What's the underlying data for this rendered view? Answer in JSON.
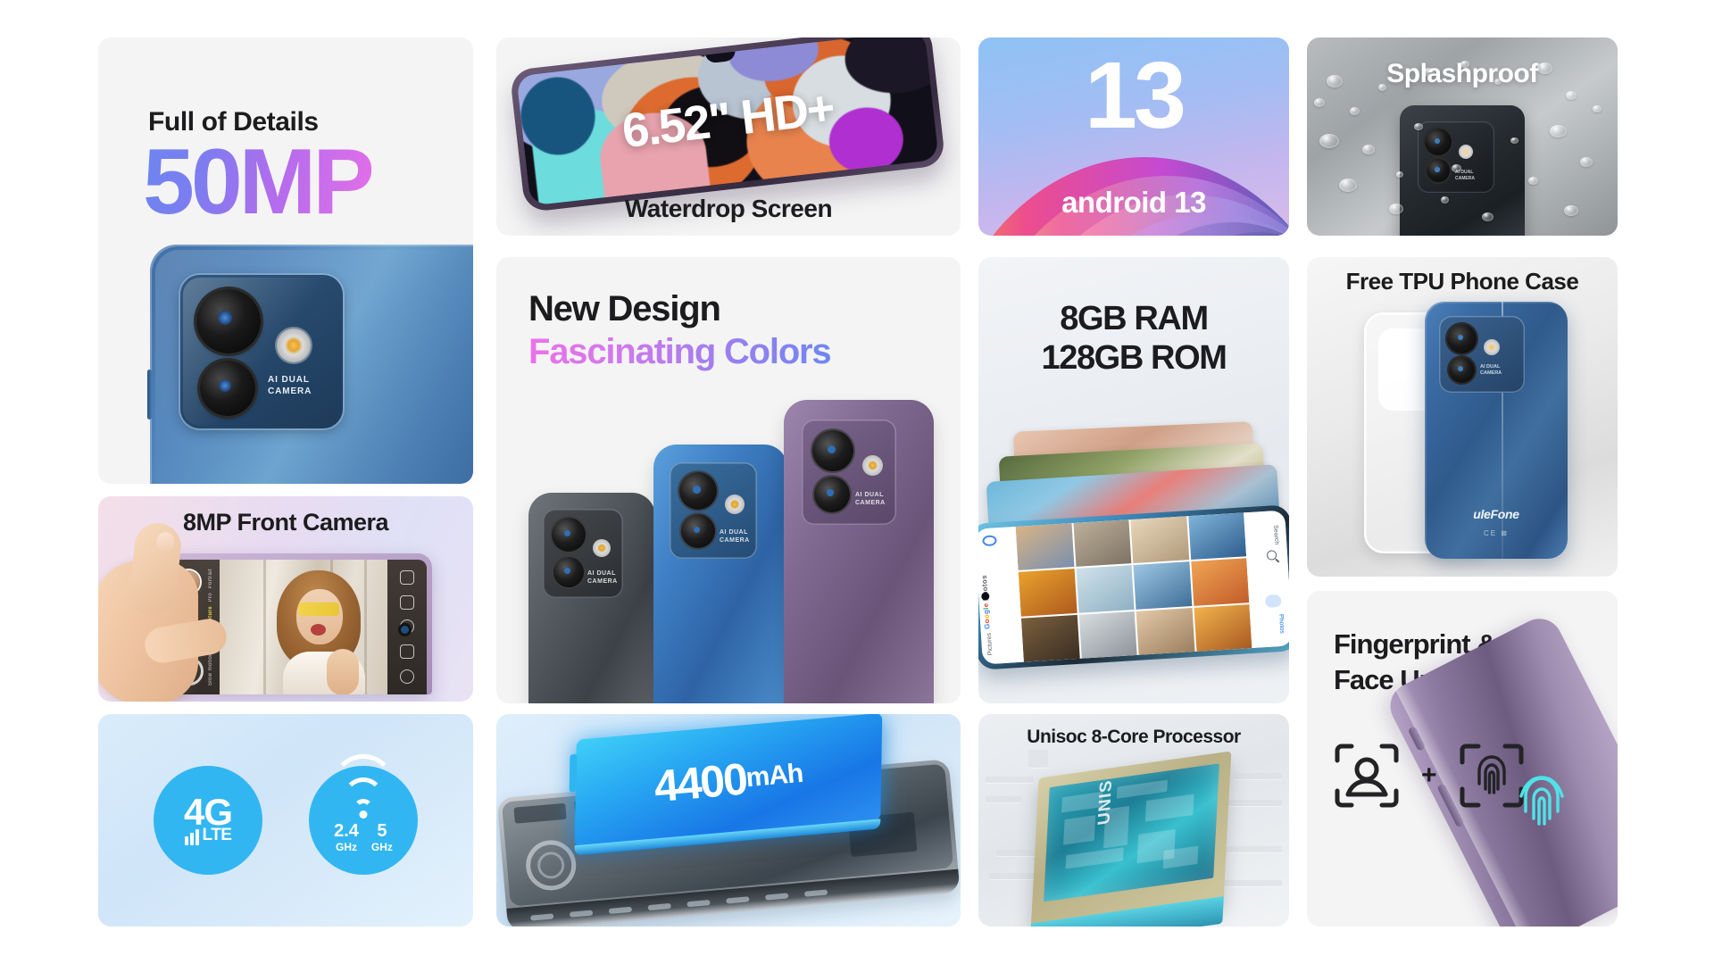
{
  "product": {
    "brand": "ulefone",
    "accent_blue": "#6b86ef",
    "accent_magenta": "#e46fe8",
    "icon_blue": "#31b6f2",
    "tile_bg": "#f4f4f4"
  },
  "tiles": {
    "camera_50mp": {
      "eyebrow": "Full of Details",
      "headline": "50MP",
      "phone_label_line1": "AI DUAL",
      "phone_label_line2": "CAMERA",
      "icon": "rear-camera-module"
    },
    "front_camera": {
      "caption": "8MP Front Camera",
      "camera_modes": [
        "Portrait",
        "Pro",
        "Capture",
        "Video",
        "Slow motion"
      ],
      "active_mode": "Capture",
      "icon": "hand-holding-phone-selfie"
    },
    "network": {
      "lte_main": "4G",
      "lte_sub": "LTE",
      "wifi_bands": [
        {
          "value": "2.4",
          "unit": "GHz"
        },
        {
          "value": "5",
          "unit": "GHz"
        }
      ],
      "icons": [
        "4g-lte-icon",
        "dual-band-wifi-icon"
      ]
    },
    "display": {
      "overlay_text": "6.52\" HD+",
      "caption": "Waterdrop Screen",
      "icon": "phone-front-display"
    },
    "design": {
      "headline": "New Design",
      "subhead": "Fascinating Colors",
      "colorways": [
        "Gray",
        "Blue",
        "Purple"
      ],
      "phone_label_line1": "AI DUAL",
      "phone_label_line2": "CAMERA"
    },
    "battery": {
      "capacity": "4400",
      "unit": "mAh",
      "icon": "battery-slab"
    },
    "android": {
      "version_number": "13",
      "caption": "android 13",
      "icon": "android-ribbons"
    },
    "memory": {
      "line1": "8GB RAM",
      "line2": "128GB ROM",
      "app_name": "Google Photos",
      "app_name_letters": [
        "G",
        "o",
        "o",
        "g",
        "l",
        "e"
      ],
      "nav_labels": [
        "Pictures",
        "Search",
        "Photos"
      ],
      "icon": "photo-gallery-grid"
    },
    "processor": {
      "caption": "Unisoc 8-Core Processor",
      "chip_brand": "UNISOC",
      "icon": "soc-chip"
    },
    "splashproof": {
      "caption": "Splashproof",
      "phone_label_line1": "AI DUAL",
      "phone_label_line2": "CAMERA",
      "icon": "water-droplets"
    },
    "tpu_case": {
      "caption": "Free TPU Phone Case",
      "brand_mark": "uleFone",
      "cert_marks": "CE ⊠",
      "phone_label_line1": "AI DUAL",
      "phone_label_line2": "CAMERA",
      "icon": "clear-tpu-case"
    },
    "unlock": {
      "headline_line1": "Fingerprint &",
      "headline_line2": "Face Unlock",
      "separator": "+",
      "icons": [
        "face-unlock-icon",
        "fingerprint-scan-icon",
        "fingerprint-glow-icon"
      ]
    }
  }
}
